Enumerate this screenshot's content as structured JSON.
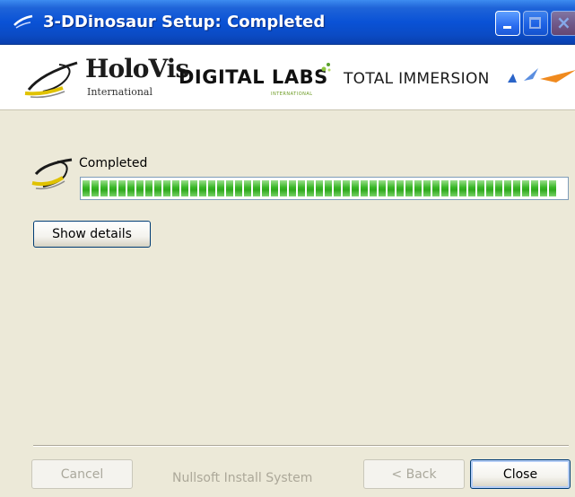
{
  "window": {
    "title": "3-DDinosaur Setup: Completed"
  },
  "banner": {
    "logos": {
      "holovis": "HoloVis",
      "holovis_sub": "International",
      "digital_labs": "DIGITAL LABS",
      "digital_labs_sub": "INTERNATIONAL",
      "total_immersion": "TOTAL IMMERSION"
    }
  },
  "progress": {
    "status_label": "Completed",
    "fraction": 1.0
  },
  "buttons": {
    "show_details": "Show details",
    "cancel": "Cancel",
    "back": "< Back",
    "close": "Close"
  },
  "footer": {
    "brand": "Nullsoft Install System"
  },
  "colors": {
    "titlebar": "#0a52d6",
    "dialog_bg": "#ece9d8",
    "progress_green": "#37b525",
    "ti_orange": "#f08a1e",
    "ti_blue": "#2a64c8"
  }
}
